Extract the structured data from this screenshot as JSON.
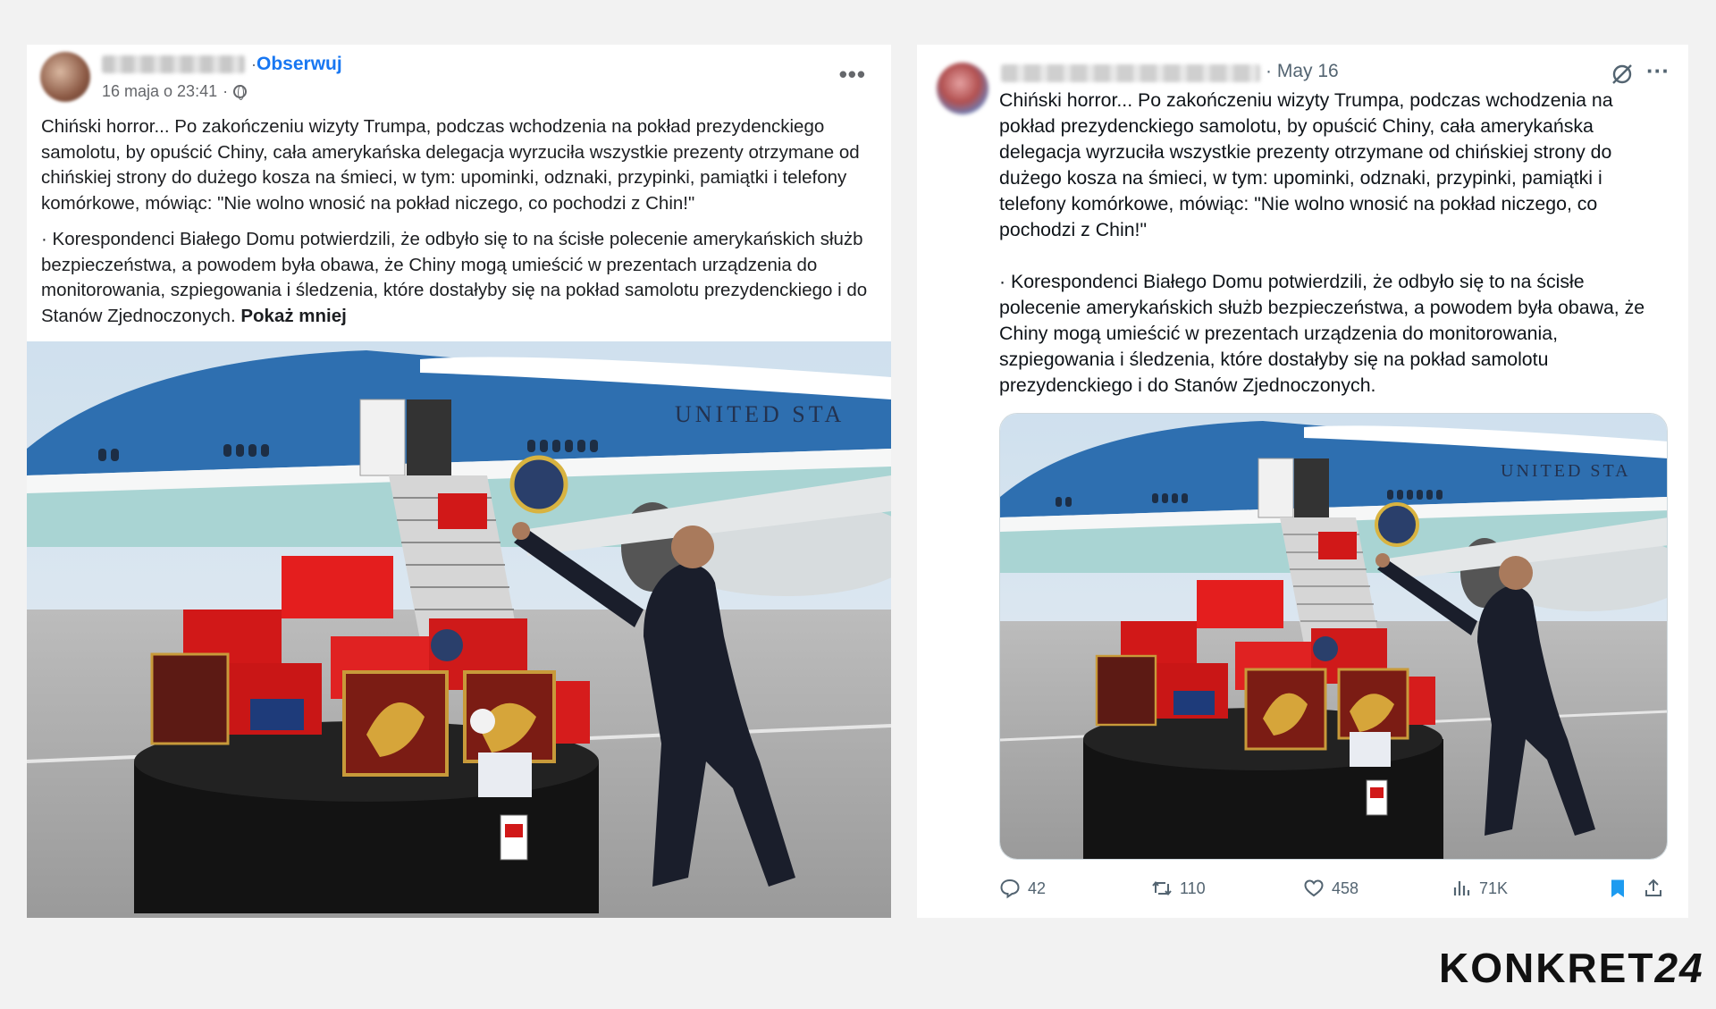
{
  "colors": {
    "fb_link": "#1877f2",
    "tw_bookmark": "#1d9bf0",
    "muted": "#65676b",
    "tw_muted": "#536471"
  },
  "facebook": {
    "follow_label": "Obserwuj",
    "date": "16 maja o 23:41",
    "privacy_icon": "globe-icon",
    "more_icon": "more-horizontal-icon",
    "more_label": "•••",
    "paragraph_1": "Chiński horror... Po zakończeniu wizyty Trumpa, podczas wchodzenia na pokład prezydenckiego samolotu, by opuścić Chiny, cała amerykańska delegacja wyrzuciła wszystkie prezenty otrzymane od chińskiej strony do dużego kosza na śmieci, w tym: upominki, odznaki, przypinki, pamiątki i telefony komórkowe, mówiąc: \"Nie wolno wnosić na pokład niczego, co pochodzi z Chin!\"",
    "paragraph_2": "· Korespondenci Białego Domu potwierdzili, że odbyło się to na ścisłe polecenie amerykańskich służb bezpieczeństwa, a powodem była obawa, że Chiny mogą umieścić w prezentach urządzenia do monitorowania, szpiegowania i śledzenia, które dostałyby się na pokład samolotu prezydenckiego i do Stanów Zjednoczonych.",
    "show_less": "Pokaż mniej",
    "photo_text": "UNITED STA"
  },
  "twitter": {
    "date": "· May 16",
    "grok_icon": "grok-icon",
    "more_label": "···",
    "paragraph_1": "Chiński horror... Po zakończeniu wizyty Trumpa, podczas wchodzenia na pokład prezydenckiego samolotu, by opuścić Chiny, cała amerykańska delegacja wyrzuciła wszystkie prezenty otrzymane od chińskiej strony do dużego kosza na śmieci, w tym: upominki, odznaki, przypinki, pamiątki i telefony komórkowe, mówiąc: \"Nie wolno wnosić na pokład niczego, co pochodzi z Chin!\"",
    "paragraph_2": "· Korespondenci Białego Domu potwierdzili, że odbyło się to na ścisłe polecenie amerykańskich służb bezpieczeństwa, a powodem była obawa, że Chiny mogą umieścić w prezentach urządzenia do monitorowania, szpiegowania i śledzenia, które dostałyby się na pokład samolotu prezydenckiego i do Stanów Zjednoczonych.",
    "photo_text": "UNITED STA",
    "actions": {
      "replies": "42",
      "reposts": "110",
      "likes": "458",
      "views": "71K"
    }
  },
  "logo": {
    "text": "KONKRET",
    "number": "24"
  }
}
